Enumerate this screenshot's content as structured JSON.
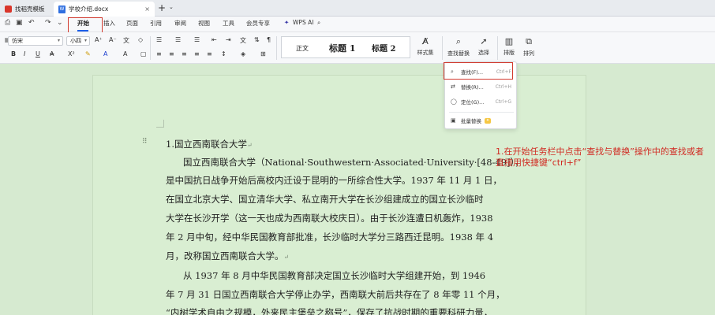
{
  "tabs": {
    "tab1_label": "找稻壳模板",
    "tab2_label": "学校介绍.docx",
    "close_glyph": "×",
    "new_tab_glyph": "+",
    "new_tab_arrow": "⌄"
  },
  "menubar": {
    "items": [
      "开始",
      "插入",
      "页面",
      "引用",
      "审阅",
      "视图",
      "工具",
      "会员专享"
    ],
    "ai_label": "WPS AI"
  },
  "ribbon": {
    "font_name": "仿宋",
    "font_size": "小四",
    "styles": [
      "正文",
      "标题 1",
      "标题 2"
    ],
    "style_set_label": "样式集",
    "find_replace_label": "查找替换",
    "select_label": "选择",
    "layout_label": "排版",
    "arrange_label": "排列"
  },
  "find_menu": {
    "items": [
      {
        "label": "查找(F)...",
        "shortcut": "Ctrl+F"
      },
      {
        "label": "替换(R)...",
        "shortcut": "Ctrl+H"
      },
      {
        "label": "定位(G)...",
        "shortcut": "Ctrl+G"
      },
      {
        "label": "批量替换",
        "shortcut": ""
      }
    ]
  },
  "document": {
    "heading": "1.国立西南联合大学",
    "lines": [
      "国立西南联合大学（National·Southwestern·Associated·University·[48-49]），",
      "是中国抗日战争开始后高校内迁设于昆明的一所综合性大学。1937 年 11 月 1 日，",
      "在国立北京大学、国立清华大学、私立南开大学在长沙组建成立的国立长沙临时",
      "大学在长沙开学（这一天也成为西南联大校庆日）。由于长沙连遭日机轰炸，1938",
      "年 2 月中旬，经中华民国教育部批准，长沙临时大学分三路西迁昆明。1938 年 4",
      "月，改称国立西南联合大学。",
      "从 1937 年 8 月中华民国教育部决定国立长沙临时大学组建开始，到 1946",
      "年 7 月 31 日国立西南联合大学停止办学，西南联大前后共存在了 8 年零 11 个月，",
      "“内树学术自由之规模，外来民主堡垒之称号”，保存了抗战时期的重要科研力量，"
    ],
    "paragraph_mark": "↵"
  },
  "annotation": {
    "text": "1.在开始任务栏中点击“查找与替换”操作中的查找或者直接用快捷键“ctrl+f”"
  },
  "colors": {
    "highlight_red": "#d23a2f",
    "accent_blue": "#1d5ee8",
    "page_bg": "#d9eed2"
  }
}
